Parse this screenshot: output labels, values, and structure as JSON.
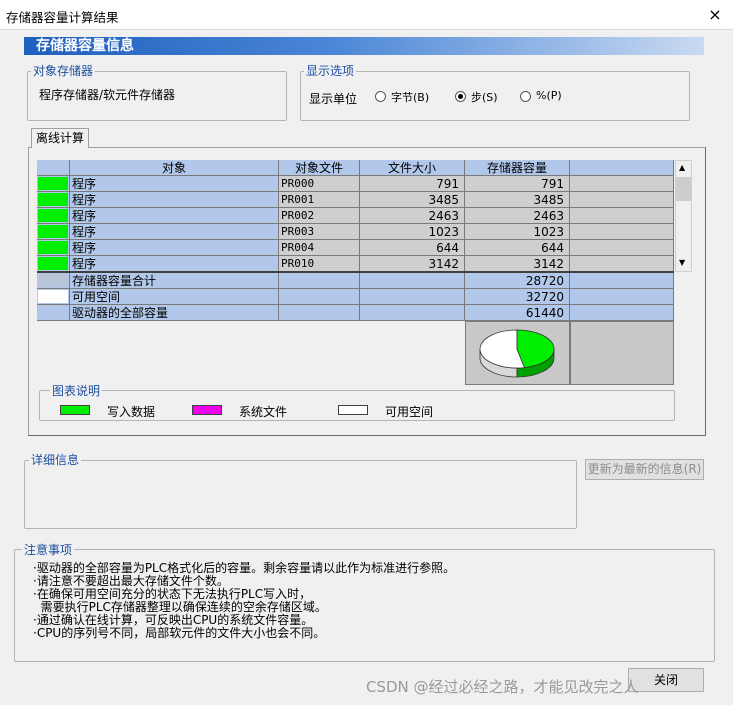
{
  "window": {
    "title": "存储器容量计算结果",
    "close_glyph": "×"
  },
  "banner": {
    "title": "存储器容量信息"
  },
  "target_memory": {
    "legend": "对象存储器",
    "value": "程序存储器/软元件存储器"
  },
  "display_options": {
    "legend": "显示选项",
    "unit_label": "显示单位",
    "options": [
      {
        "label": "字节(B)",
        "selected": false
      },
      {
        "label": "步(S)",
        "selected": true
      },
      {
        "label": "%(P)",
        "selected": false
      }
    ]
  },
  "tab": {
    "label": "离线计算"
  },
  "table": {
    "headers": [
      "",
      "对象",
      "对象文件",
      "文件大小",
      "存储器容量",
      ""
    ],
    "rows": [
      {
        "color": "#00ee00",
        "object": "程序",
        "file": "PR000",
        "size": "791",
        "capacity": "791"
      },
      {
        "color": "#00ee00",
        "object": "程序",
        "file": "PR001",
        "size": "3485",
        "capacity": "3485"
      },
      {
        "color": "#00ee00",
        "object": "程序",
        "file": "PR002",
        "size": "2463",
        "capacity": "2463"
      },
      {
        "color": "#00ee00",
        "object": "程序",
        "file": "PR003",
        "size": "1023",
        "capacity": "1023"
      },
      {
        "color": "#00ee00",
        "object": "程序",
        "file": "PR004",
        "size": "644",
        "capacity": "644"
      },
      {
        "color": "#00ee00",
        "object": "程序",
        "file": "PR010",
        "size": "3142",
        "capacity": "3142"
      }
    ],
    "summary": [
      {
        "color": "#b8c4d8",
        "label": "存储器容量合计",
        "value": "28720"
      },
      {
        "color": "#ffffff",
        "label": "可用空间",
        "value": "32720"
      },
      {
        "color": "#b1c8ea",
        "label": "驱动器的全部容量",
        "value": "61440"
      }
    ]
  },
  "pie": {
    "used_fraction": 0.4674,
    "used_color": "#00ee00",
    "free_color": "#ffffff"
  },
  "chart_legend": {
    "title": "图表说明",
    "items": [
      {
        "label": "写入数据",
        "color": "#00ee00"
      },
      {
        "label": "系统文件",
        "color": "#ee00ee"
      },
      {
        "label": "可用空间",
        "color": "#ffffff"
      }
    ]
  },
  "details": {
    "legend": "详细信息",
    "refresh_button": "更新为最新的信息(R)"
  },
  "notes": {
    "legend": "注意事项",
    "lines": [
      "·驱动器的全部容量为PLC格式化后的容量。剩余容量请以此作为标准进行参照。",
      "·请注意不要超出最大存储文件个数。",
      "·在确保可用空间充分的状态下无法执行PLC写入时，",
      "  需要执行PLC存储器整理以确保连续的空余存储区域。",
      "·通过确认在线计算，可反映出CPU的系统文件容量。",
      "·CPU的序列号不同，局部软元件的文件大小也会不同。"
    ]
  },
  "close_button": "关闭",
  "watermark": "CSDN @经过必经之路，才能见改完之人"
}
